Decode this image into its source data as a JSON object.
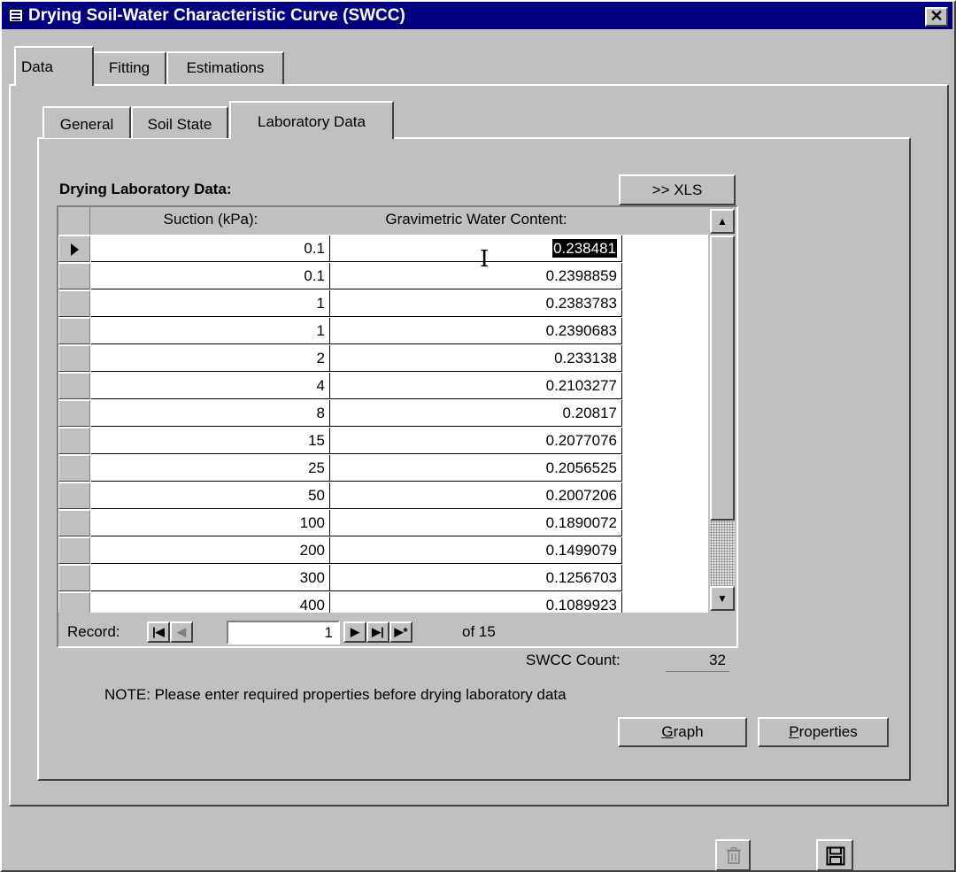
{
  "window": {
    "title": "Drying Soil-Water Characteristic Curve (SWCC)",
    "close": "✕"
  },
  "main_tabs": [
    {
      "label": "Data"
    },
    {
      "label": "Fitting"
    },
    {
      "label": "Estimations"
    }
  ],
  "sub_tabs": [
    {
      "label": "General"
    },
    {
      "label": "Soil State"
    },
    {
      "label": "Laboratory Data"
    }
  ],
  "lab": {
    "heading": "Drying Laboratory Data:",
    "xls_button": ">> XLS",
    "columns": [
      "Suction (kPa):",
      "Gravimetric Water Content:"
    ],
    "rows": [
      {
        "suction": "0.1",
        "water": "0.238481"
      },
      {
        "suction": "0.1",
        "water": "0.2398859"
      },
      {
        "suction": "1",
        "water": "0.2383783"
      },
      {
        "suction": "1",
        "water": "0.2390683"
      },
      {
        "suction": "2",
        "water": "0.233138"
      },
      {
        "suction": "4",
        "water": "0.2103277"
      },
      {
        "suction": "8",
        "water": "0.20817"
      },
      {
        "suction": "15",
        "water": "0.2077076"
      },
      {
        "suction": "25",
        "water": "0.2056525"
      },
      {
        "suction": "50",
        "water": "0.2007206"
      },
      {
        "suction": "100",
        "water": "0.1890072"
      },
      {
        "suction": "200",
        "water": "0.1499079"
      },
      {
        "suction": "300",
        "water": "0.1256703"
      },
      {
        "suction": "400",
        "water": "0.1089923"
      }
    ],
    "record_label": "Record:",
    "record_value": "1",
    "record_of": "of  15",
    "count_label": "SWCC Count:",
    "count_value": "32",
    "note": "NOTE: Please enter required properties before drying laboratory data",
    "graph_button": "Graph",
    "properties_button": "Properties"
  }
}
